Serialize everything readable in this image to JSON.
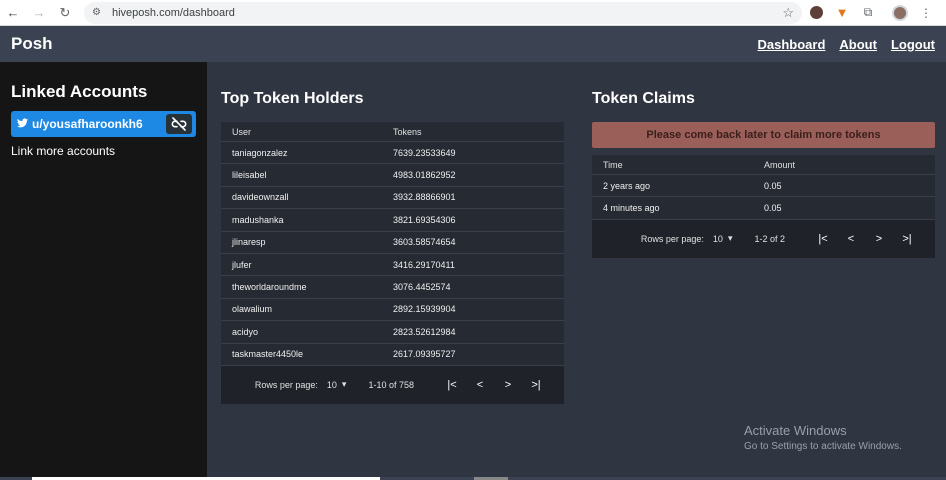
{
  "browser": {
    "url": "hiveposh.com/dashboard"
  },
  "app": {
    "brand": "Posh",
    "nav": [
      "Dashboard",
      "About",
      "Logout"
    ]
  },
  "sidebar": {
    "title": "Linked Accounts",
    "account": "u/yousafharoonkh6",
    "link_more": "Link more accounts"
  },
  "holders": {
    "title": "Top Token Holders",
    "columns": [
      "User",
      "Tokens"
    ],
    "rows": [
      [
        "taniagonzalez",
        "7639.23533649"
      ],
      [
        "lileisabel",
        "4983.01862952"
      ],
      [
        "davideownzall",
        "3932.88866901"
      ],
      [
        "madushanka",
        "3821.69354306"
      ],
      [
        "jlinaresp",
        "3603.58574654"
      ],
      [
        "jlufer",
        "3416.29170411"
      ],
      [
        "theworldaroundme",
        "3076.4452574"
      ],
      [
        "olawalium",
        "2892.15939904"
      ],
      [
        "acidyo",
        "2823.52612984"
      ],
      [
        "taskmaster4450le",
        "2617.09395727"
      ]
    ],
    "pager": {
      "rows_label": "Rows per page:",
      "rows_value": "10",
      "range": "1-10 of 758"
    }
  },
  "claims": {
    "title": "Token Claims",
    "alert": "Please come back later to claim more tokens",
    "columns": [
      "Time",
      "Amount"
    ],
    "rows": [
      [
        "2 years ago",
        "0.05"
      ],
      [
        "4 minutes ago",
        "0.05"
      ]
    ],
    "pager": {
      "rows_label": "Rows per page:",
      "rows_value": "10",
      "range": "1-2 of 2"
    }
  },
  "watermark": {
    "line1": "Activate Windows",
    "line2": "Go to Settings to activate Windows."
  },
  "colors": {
    "accent_blue": "#1e88e5",
    "alert_bg": "#9a5f58",
    "sidebar_bg": "#151515",
    "content_bg": "#2f3541"
  }
}
